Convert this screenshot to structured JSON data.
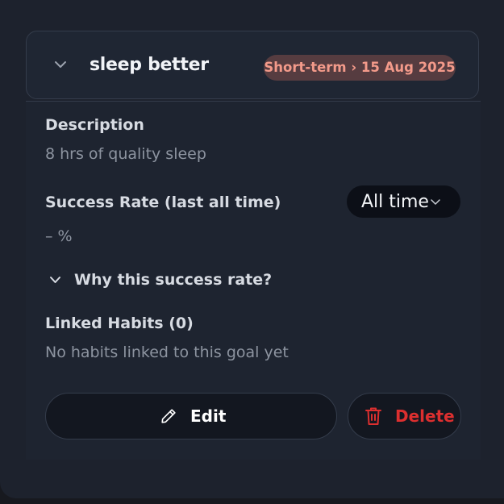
{
  "goal": {
    "title": "sleep better",
    "badge": "Short-term › 15 Aug 2025"
  },
  "description": {
    "label": "Description",
    "text": "8 hrs of quality sleep"
  },
  "success_rate": {
    "label": "Success Rate (last all time)",
    "value": "– %",
    "period_selected": "All time"
  },
  "why": {
    "label": "Why this success rate?"
  },
  "linked_habits": {
    "label": "Linked Habits (0)",
    "empty_text": "No habits linked to this goal yet"
  },
  "actions": {
    "edit_label": "Edit",
    "delete_label": "Delete"
  },
  "icons": {
    "expand": "chevron-down-icon",
    "edit": "pencil-icon",
    "delete": "trash-icon"
  },
  "colors": {
    "badge_bg": "#563c40",
    "badge_text": "#f39a8a",
    "delete": "#dc2f2f"
  }
}
